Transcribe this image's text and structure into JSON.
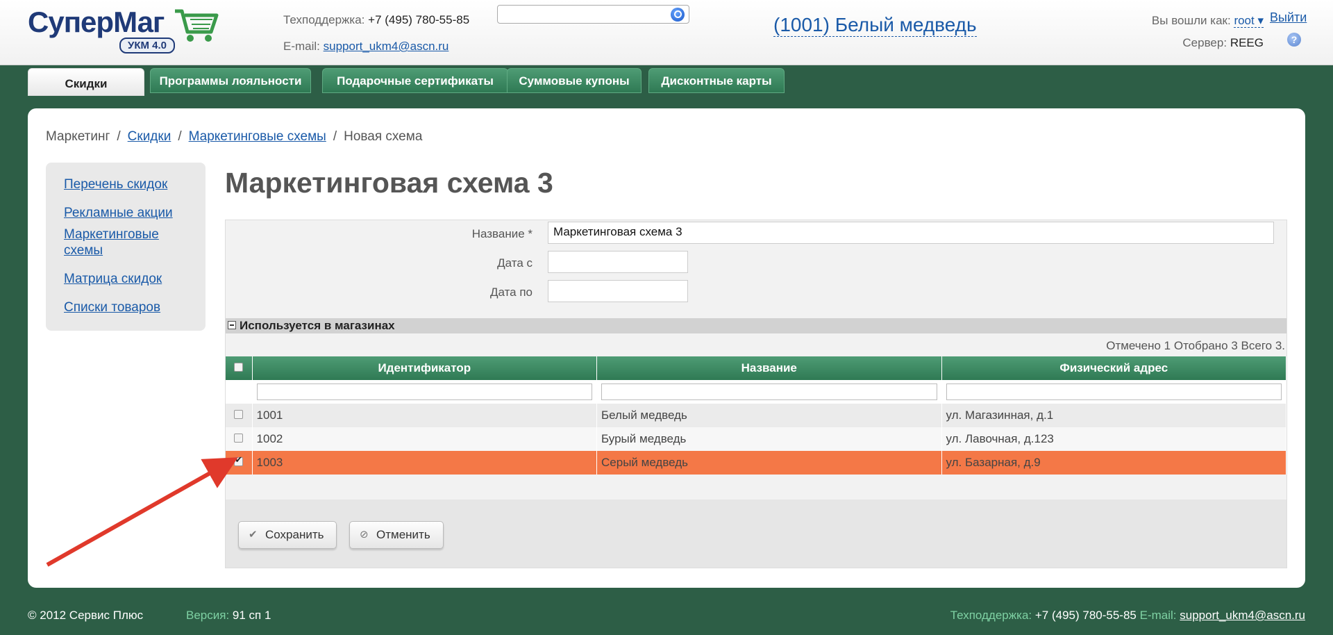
{
  "header": {
    "logo": {
      "text_part1": "Супер",
      "text_part2": "Маг",
      "badge": "УКМ 4.0"
    },
    "support": {
      "phone_label": "Техподдержка:",
      "phone": "+7 (495) 780-55-85",
      "email_label": "E-mail:",
      "email": "support_ukm4@ascn.ru"
    },
    "search": {
      "placeholder": ""
    },
    "store": "(1001) Белый медведь",
    "login_label": "Вы вошли как:",
    "user": "root ▾",
    "logout": "Выйти",
    "server_label": "Сервер:",
    "server": "REEG"
  },
  "tabs": [
    {
      "label": "Скидки",
      "active": true
    },
    {
      "label": "Программы лояльности"
    },
    {
      "label": "Подарочные сертификаты"
    },
    {
      "label": "Суммовые купоны"
    },
    {
      "label": "Дисконтные карты"
    }
  ],
  "breadcrumb": {
    "root": "Маркетинг",
    "link1": "Скидки",
    "link2": "Маркетинговые схемы",
    "current": "Новая схема",
    "sep": "/"
  },
  "sidebar": {
    "items": [
      "Перечень скидок",
      "Рекламные акции",
      "Маркетинговые схемы",
      "Матрица скидок",
      "Списки товаров"
    ]
  },
  "page_title": "Маркетинговая схема 3",
  "form": {
    "name_label": "Название *",
    "name_value": "Маркетинговая схема 3",
    "date_from_label": "Дата с",
    "date_from_value": "",
    "date_to_label": "Дата по",
    "date_to_value": ""
  },
  "section": {
    "title": "Используется в магазинах"
  },
  "counts": "Отмечено 1 Отобрано 3 Всего 3.",
  "table": {
    "columns": [
      "Идентификатор",
      "Название",
      "Физический адрес"
    ],
    "rows": [
      {
        "id": "1001",
        "name": "Белый медведь",
        "address": "ул. Магазинная, д.1",
        "checked": false
      },
      {
        "id": "1002",
        "name": "Бурый медведь",
        "address": "ул. Лавочная, д.123",
        "checked": false
      },
      {
        "id": "1003",
        "name": "Серый медведь",
        "address": "ул. Базарная, д.9",
        "checked": true
      }
    ]
  },
  "buttons": {
    "save": "Сохранить",
    "cancel": "Отменить"
  },
  "footer": {
    "copyright": "© 2012 Сервис Плюс",
    "version_label": "Версия:",
    "version": "91 сп 1",
    "support_label": "Техподдержка:",
    "phone": "+7 (495) 780-55-85",
    "email_label": "E-mail:",
    "email": "support_ukm4@ascn.ru"
  },
  "colors": {
    "green": "#2d5e46",
    "selected_row": "#f47847",
    "link": "#1a5aa8",
    "arrow": "#e0392b"
  }
}
